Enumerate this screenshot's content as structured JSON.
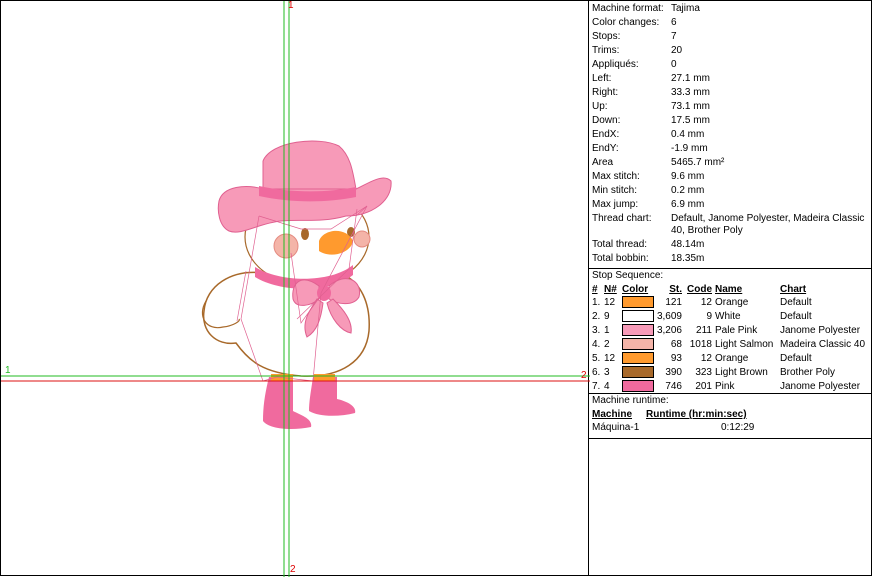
{
  "canvas": {
    "axis_labels": {
      "v_top": "1",
      "v_bottom": "2",
      "h_left": "1",
      "h_right": "2"
    },
    "colors": {
      "green": "#22bb22",
      "red": "#dd1111"
    }
  },
  "info": [
    {
      "key": "Machine format:",
      "value": "Tajima"
    },
    {
      "key": "Color changes:",
      "value": "6"
    },
    {
      "key": "Stops:",
      "value": "7"
    },
    {
      "key": "Trims:",
      "value": "20"
    },
    {
      "key": "Appliqués:",
      "value": "0"
    },
    {
      "key": "Left:",
      "value": "27.1 mm"
    },
    {
      "key": "Right:",
      "value": "33.3 mm"
    },
    {
      "key": "Up:",
      "value": "73.1 mm"
    },
    {
      "key": "Down:",
      "value": "17.5 mm"
    },
    {
      "key": "EndX:",
      "value": "0.4 mm"
    },
    {
      "key": "EndY:",
      "value": "-1.9 mm"
    },
    {
      "key": "Area",
      "value": "5465.7 mm²"
    },
    {
      "key": "Max stitch:",
      "value": "9.6 mm"
    },
    {
      "key": "Min stitch:",
      "value": "0.2 mm"
    },
    {
      "key": "Max jump:",
      "value": "6.9 mm"
    },
    {
      "key": "Thread chart:",
      "value": "Default, Janome Polyester, Madeira Classic 40, Brother Poly"
    },
    {
      "key": "Total thread:",
      "value": "48.14m"
    },
    {
      "key": "Total bobbin:",
      "value": "18.35m"
    }
  ],
  "stops": {
    "title": "Stop Sequence:",
    "headers": {
      "idx": "#",
      "n": "N#",
      "color": "Color",
      "st": "St.",
      "code": "Code",
      "name": "Name",
      "chart": "Chart"
    },
    "rows": [
      {
        "idx": "1.",
        "n": "12",
        "color": "#ff9a2e",
        "st": "121",
        "code": "12",
        "name": "Orange",
        "chart": "Default"
      },
      {
        "idx": "2.",
        "n": "9",
        "color": "#ffffff",
        "st": "3,609",
        "code": "9",
        "name": "White",
        "chart": "Default"
      },
      {
        "idx": "3.",
        "n": "1",
        "color": "#f79ab8",
        "st": "3,206",
        "code": "211",
        "name": "Pale Pink",
        "chart": "Janome Polyester"
      },
      {
        "idx": "4.",
        "n": "2",
        "color": "#f4b4a8",
        "st": "68",
        "code": "1018",
        "name": "Light Salmon",
        "chart": "Madeira Classic 40"
      },
      {
        "idx": "5.",
        "n": "12",
        "color": "#ff9a2e",
        "st": "93",
        "code": "12",
        "name": "Orange",
        "chart": "Default"
      },
      {
        "idx": "6.",
        "n": "3",
        "color": "#a8692a",
        "st": "390",
        "code": "323",
        "name": "Light Brown",
        "chart": "Brother Poly"
      },
      {
        "idx": "7.",
        "n": "4",
        "color": "#f06a9e",
        "st": "746",
        "code": "201",
        "name": "Pink",
        "chart": "Janome Polyester"
      }
    ]
  },
  "runtime": {
    "title": "Machine runtime:",
    "headers": {
      "machine": "Machine",
      "runtime": "Runtime (hr:min:sec)"
    },
    "rows": [
      {
        "machine": "Máquina-1",
        "runtime": "0:12:29"
      }
    ]
  }
}
